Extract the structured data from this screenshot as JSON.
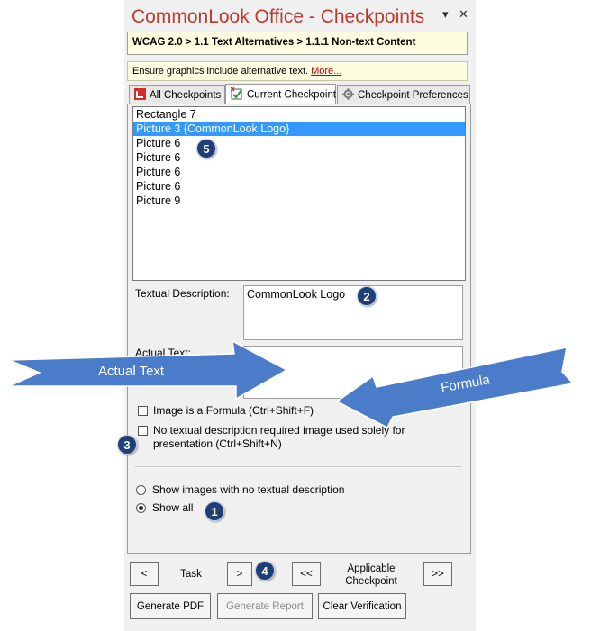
{
  "window": {
    "title": "CommonLook Office - Checkpoints",
    "title_color": "#c0392b",
    "dropdown_icon": "▾",
    "close_icon": "✕"
  },
  "breadcrumb": "WCAG 2.0 > 1.1 Text Alternatives > 1.1.1 Non-text Content",
  "hint": {
    "text": "Ensure graphics include alternative text. ",
    "link": "More..."
  },
  "tabs": [
    {
      "label": "All Checkpoints",
      "icon": "checkpoints-icon"
    },
    {
      "label": "Current Checkpoint",
      "icon": "current-checkpoint-icon"
    },
    {
      "label": "Checkpoint Preferences",
      "icon": "preferences-icon"
    }
  ],
  "list_items": [
    "Rectangle 7",
    "Picture 3 {CommonLook Logo}",
    "Picture 6",
    "Picture 6",
    "Picture 6",
    "Picture 6",
    "Picture 9"
  ],
  "selected_index": 1,
  "fields": {
    "textual_description_label": "Textual Description:",
    "textual_description_value": "CommonLook Logo",
    "actual_text_label": "Actual Text:",
    "actual_text_value": ""
  },
  "checkboxes": {
    "formula": "Image is a Formula (Ctrl+Shift+F)",
    "no_description_line1": "No textual description required image used solely for",
    "no_description_line2": "presentation (Ctrl+Shift+N)"
  },
  "radios": {
    "no_description": "Show images with no textual description",
    "show_all": "Show all",
    "selected": "show_all"
  },
  "navigation": {
    "prev_task": "<",
    "task_label": "Task",
    "next_task": ">",
    "prev_checkpoint": "<<",
    "checkpoint_label_line1": "Applicable",
    "checkpoint_label_line2": "Checkpoint",
    "next_checkpoint": ">>"
  },
  "actions": {
    "generate_pdf": "Generate PDF",
    "generate_report": "Generate Report",
    "clear_verification": "Clear Verification"
  },
  "annotations": {
    "actual_text_arrow": "Actual Text",
    "formula_arrow": "Formula",
    "badges": [
      "1",
      "2",
      "3",
      "4",
      "5"
    ],
    "arrow_color": "#4a7cc9"
  }
}
